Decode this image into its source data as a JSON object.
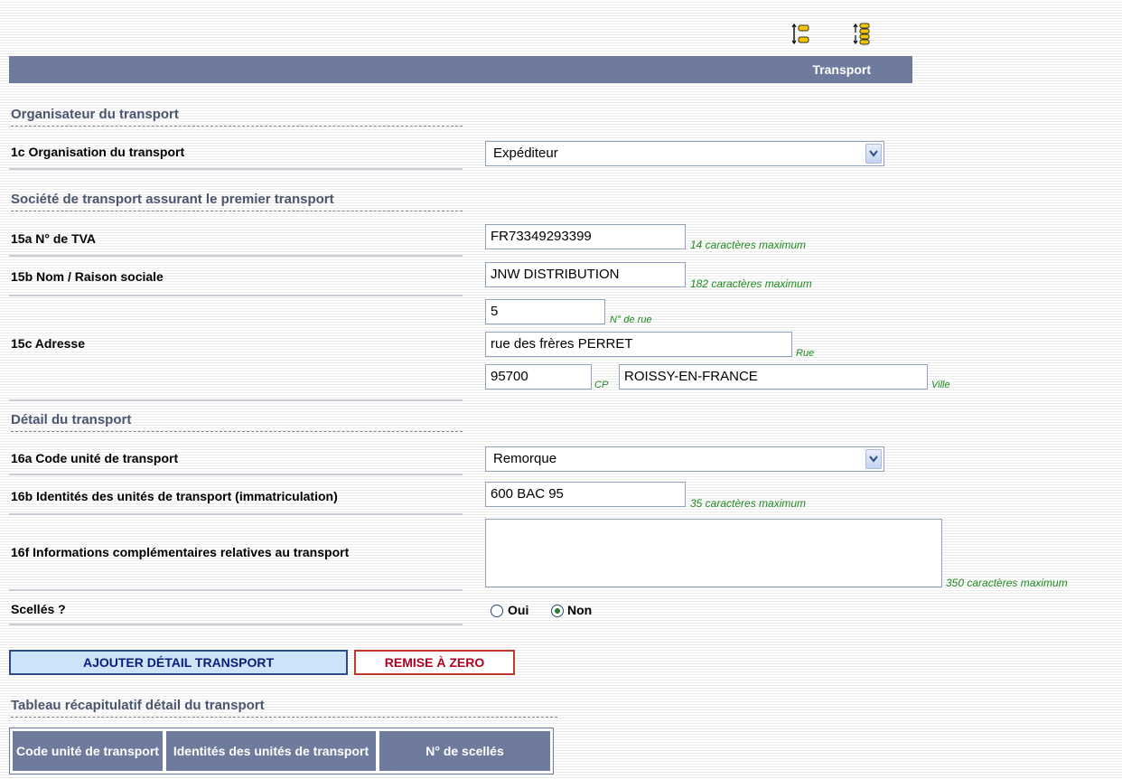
{
  "header": {
    "title": "Transport"
  },
  "sections": {
    "organisateur": "Organisateur du transport",
    "societe": "Société de transport assurant le premier transport",
    "detail": "Détail du transport",
    "recap": "Tableau récapitulatif détail du transport"
  },
  "fields": {
    "organisation": {
      "label": "1c Organisation du transport",
      "value": "Expéditeur"
    },
    "tva": {
      "label": "15a N° de TVA",
      "value": "FR73349293399",
      "hint": "14 caractères maximum"
    },
    "nom": {
      "label": "15b Nom / Raison sociale",
      "value": "JNW DISTRIBUTION",
      "hint": "182 caractères maximum"
    },
    "adresse": {
      "label": "15c Adresse",
      "numero": "5",
      "numero_hint": "N° de rue",
      "rue": "rue des frères PERRET",
      "rue_hint": "Rue",
      "cp": "95700",
      "cp_hint": "CP",
      "ville": "ROISSY-EN-FRANCE",
      "ville_hint": "Ville"
    },
    "code_unite": {
      "label": "16a Code unité de transport",
      "value": "Remorque"
    },
    "identites": {
      "label": "16b Identités des unités de transport (immatriculation)",
      "value": "600 BAC 95",
      "hint": "35 caractères maximum"
    },
    "infos": {
      "label": "16f Informations complémentaires relatives au transport",
      "value": "",
      "hint": "350 caractères maximum"
    },
    "scelles": {
      "label": "Scellés ?",
      "options": [
        "Oui",
        "Non"
      ],
      "selected": "Non"
    }
  },
  "buttons": {
    "add": "AJOUTER DÉTAIL TRANSPORT",
    "reset": "REMISE À ZERO"
  },
  "table": {
    "headers": [
      "Code unité de transport",
      "Identités des unités de transport",
      "N° de scellés"
    ]
  },
  "toolbar": {
    "icons": [
      "expand-all-icon",
      "list-collapse-icon"
    ]
  }
}
